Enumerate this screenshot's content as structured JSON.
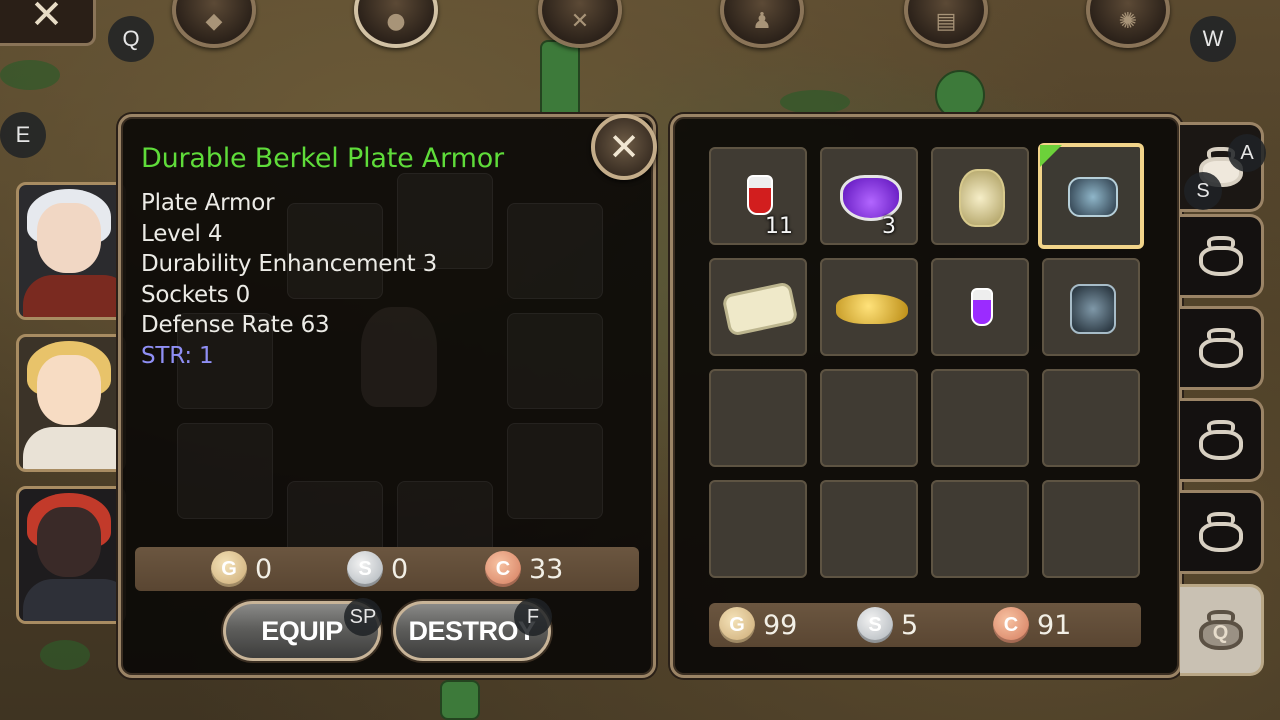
{
  "hud": {
    "close_glyph": "✕",
    "keys": {
      "q": "Q",
      "w": "W",
      "e": "E",
      "a": "A",
      "s": "S"
    }
  },
  "item": {
    "name": "Durable Berkel Plate Armor",
    "name_color": "#5fdc3a",
    "stats": [
      "Plate Armor",
      "Level 4",
      "Durability Enhancement 3",
      "Sockets 0",
      "Defense Rate 63"
    ],
    "requirement": "STR: 1",
    "price": {
      "gold": "0",
      "silver": "0",
      "copper": "33"
    },
    "coin_letters": {
      "gold": "G",
      "silver": "S",
      "copper": "C"
    }
  },
  "actions": {
    "equip_label": "EQUIP",
    "equip_key": "SP",
    "destroy_label": "DESTROY",
    "destroy_key": "F"
  },
  "inventory": {
    "slots": [
      {
        "icon": "red-potion-icon",
        "qty": "11"
      },
      {
        "icon": "purple-potion-icon",
        "qty": "3"
      },
      {
        "icon": "vase-icon",
        "qty": ""
      },
      {
        "icon": "plate-armor-icon",
        "qty": "",
        "selected": true
      },
      {
        "icon": "scroll-icon",
        "qty": ""
      },
      {
        "icon": "magic-lamp-icon",
        "qty": ""
      },
      {
        "icon": "small-purple-potion-icon",
        "qty": ""
      },
      {
        "icon": "dark-armor-icon",
        "qty": ""
      }
    ],
    "money": {
      "gold": "99",
      "silver": "5",
      "copper": "91"
    }
  },
  "tabs": {
    "quest_bag_letter": "Q"
  }
}
